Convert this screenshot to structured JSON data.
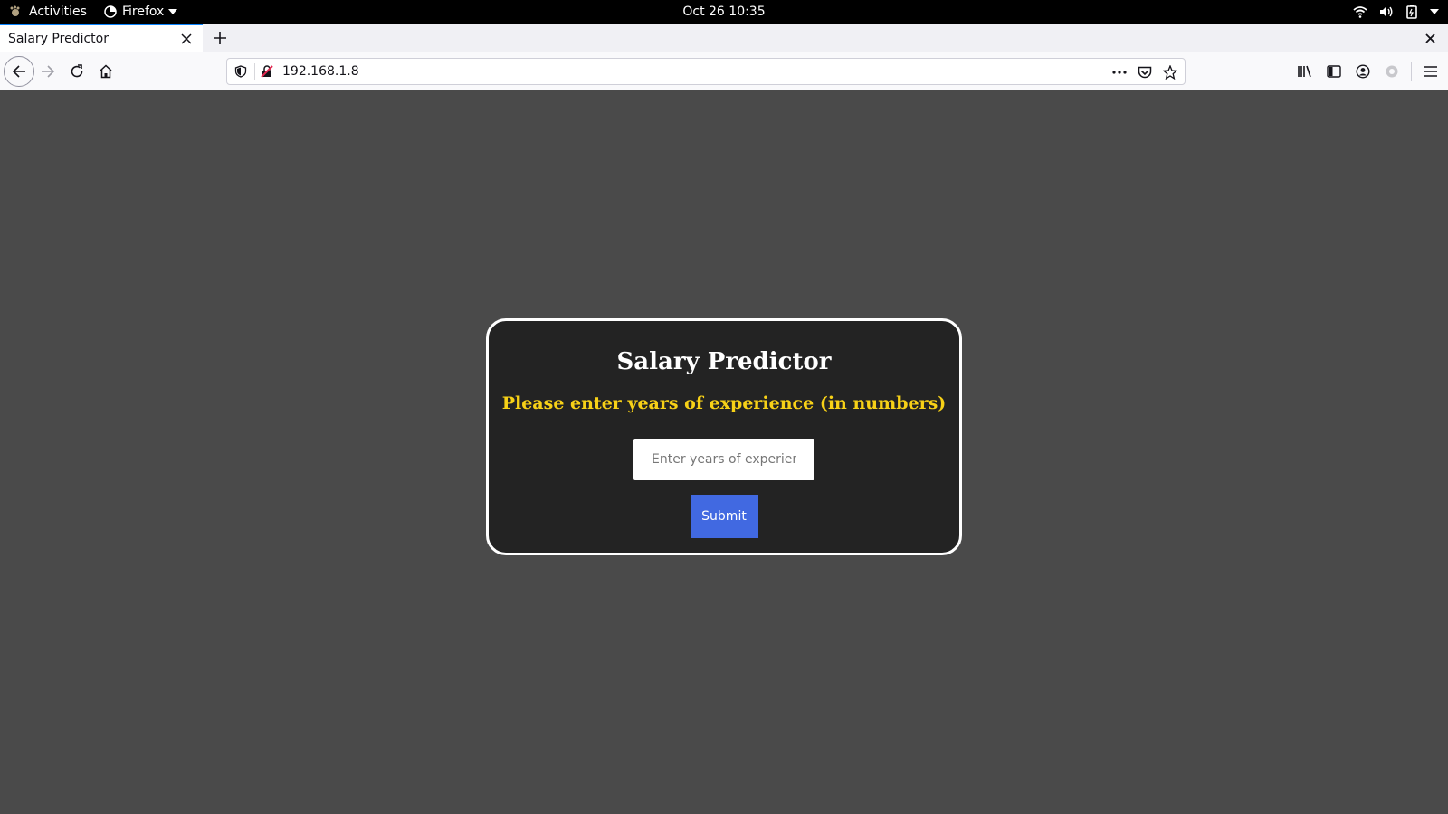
{
  "topbar": {
    "activities": "Activities",
    "app_menu": "Firefox",
    "clock": "Oct 26  10:35",
    "icons": [
      "wifi-icon",
      "volume-icon",
      "battery-icon",
      "chevron-down-icon"
    ]
  },
  "browser": {
    "tab_title": "Salary Predictor",
    "url": "192.168.1.8",
    "accent": "#0a84ff"
  },
  "page": {
    "title": "Salary Predictor",
    "subtitle": "Please enter years of experience (in numbers)",
    "input_placeholder": "Enter years of experience",
    "input_value": "",
    "submit_label": "Submit",
    "colors": {
      "background": "#4a4a4a",
      "card": "#232323",
      "subtitle": "#f7d117",
      "button": "#4169e1"
    }
  }
}
